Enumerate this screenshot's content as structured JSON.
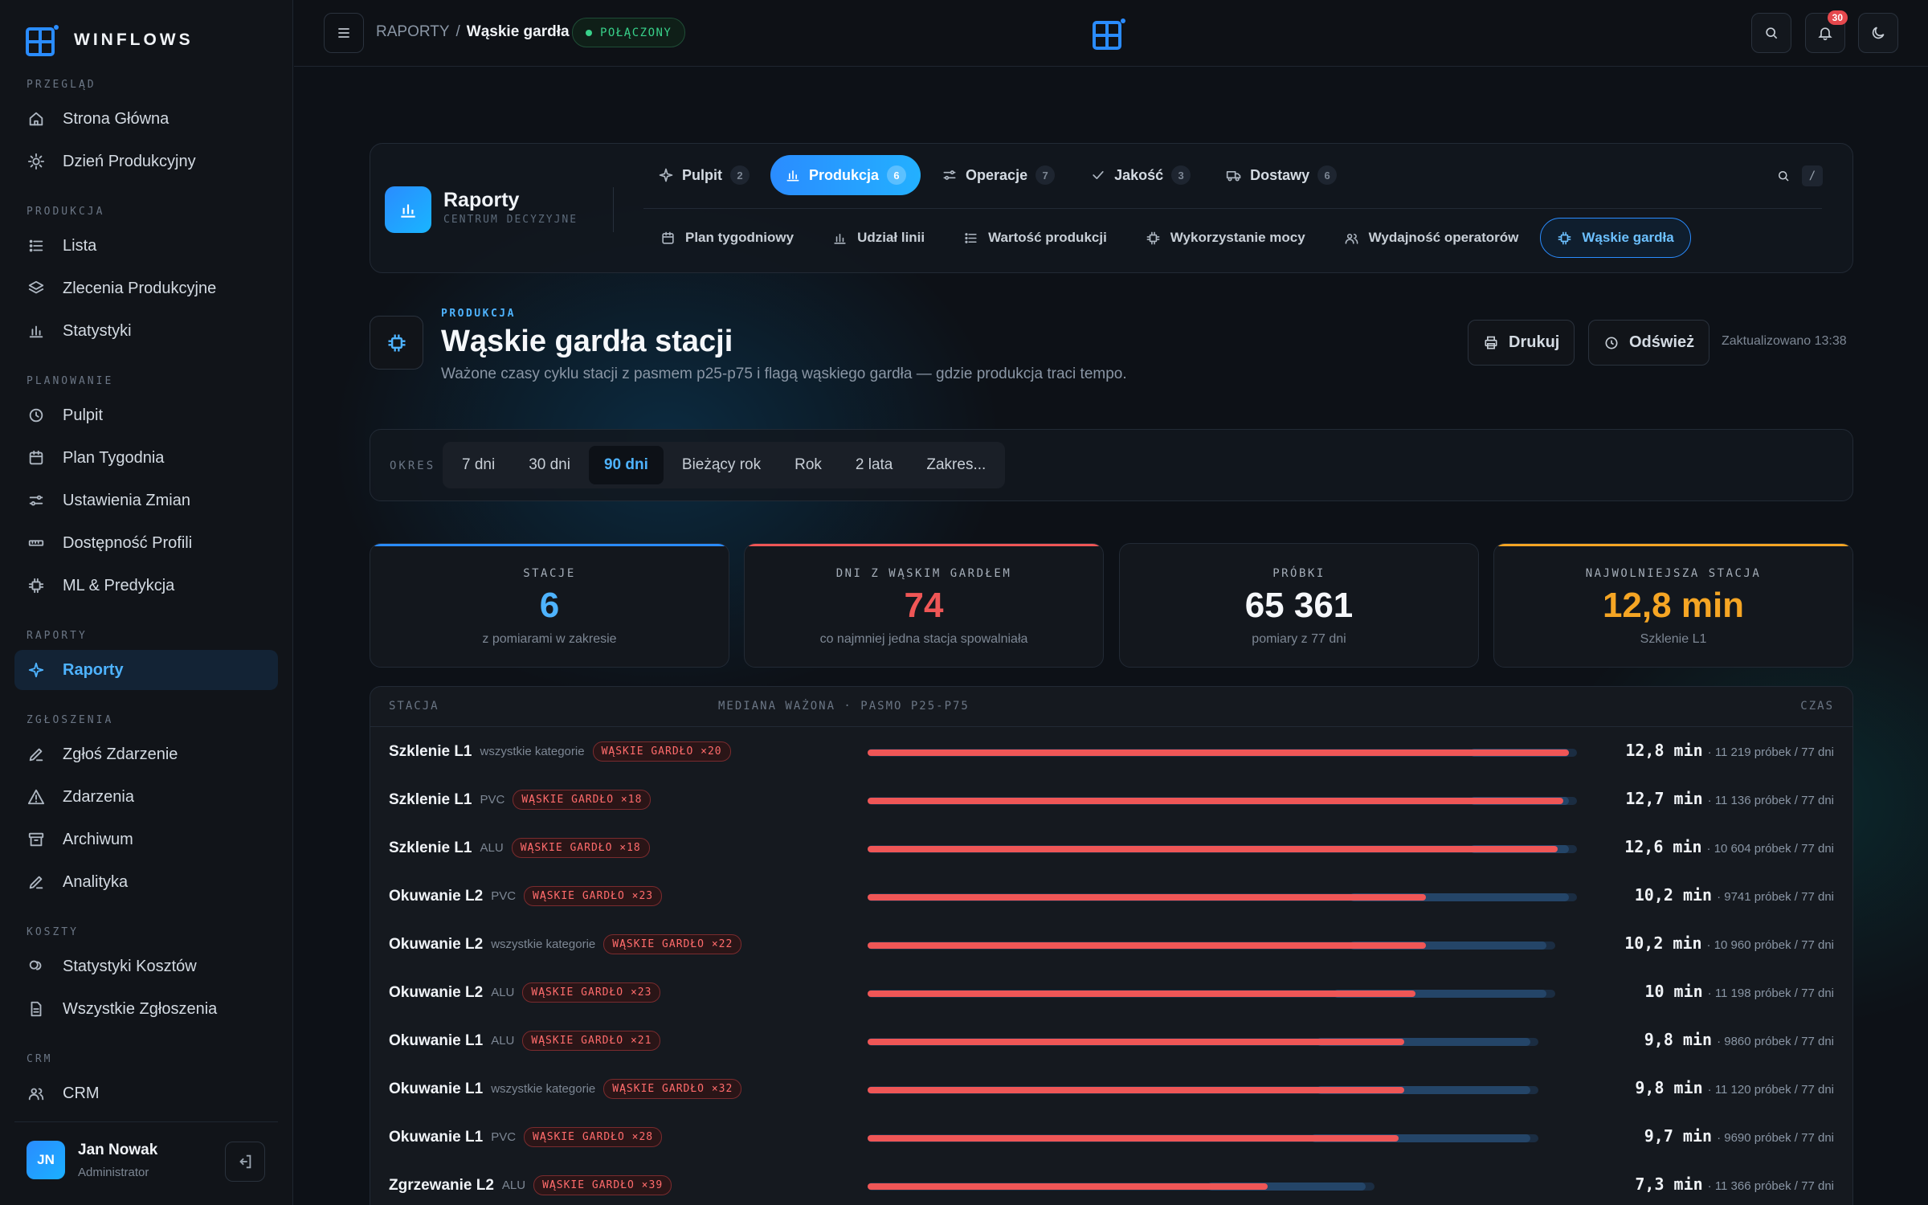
{
  "brand": {
    "name": "WINFLOWS"
  },
  "sidebar": {
    "sections": [
      {
        "title": "PRZEGLĄD",
        "items": [
          {
            "label": "Strona Główna",
            "icon": "home-icon"
          },
          {
            "label": "Dzień Produkcyjny",
            "icon": "sun-icon"
          }
        ]
      },
      {
        "title": "PRODUKCJA",
        "items": [
          {
            "label": "Lista",
            "icon": "list-icon"
          },
          {
            "label": "Zlecenia Produkcyjne",
            "icon": "layers-icon"
          },
          {
            "label": "Statystyki",
            "icon": "bar-chart-icon"
          }
        ]
      },
      {
        "title": "PLANOWANIE",
        "items": [
          {
            "label": "Pulpit",
            "icon": "clock-icon"
          },
          {
            "label": "Plan Tygodnia",
            "icon": "calendar-icon"
          },
          {
            "label": "Ustawienia Zmian",
            "icon": "sliders-icon"
          },
          {
            "label": "Dostępność Profili",
            "icon": "ruler-icon"
          },
          {
            "label": "ML & Predykcja",
            "icon": "chip-icon"
          }
        ]
      },
      {
        "title": "RAPORTY",
        "items": [
          {
            "label": "Raporty",
            "icon": "sparkle-icon",
            "active": true
          }
        ]
      },
      {
        "title": "ZGŁOSZENIA",
        "items": [
          {
            "label": "Zgłoś Zdarzenie",
            "icon": "pen-icon"
          },
          {
            "label": "Zdarzenia",
            "icon": "warning-icon"
          },
          {
            "label": "Archiwum",
            "icon": "archive-icon"
          },
          {
            "label": "Analityka",
            "icon": "pen-icon"
          }
        ]
      },
      {
        "title": "KOSZTY",
        "items": [
          {
            "label": "Statystyki Kosztów",
            "icon": "coins-icon"
          },
          {
            "label": "Wszystkie Zgłoszenia",
            "icon": "document-icon"
          }
        ]
      },
      {
        "title": "CRM",
        "items": [
          {
            "label": "CRM",
            "icon": "users-icon"
          }
        ]
      }
    ],
    "user": {
      "initials": "JN",
      "name": "Jan Nowak",
      "role": "Administrator"
    }
  },
  "topbar": {
    "breadcrumb": [
      "RAPORTY",
      "Wąskie gardła"
    ],
    "breadcrumb_sep": "/",
    "status": "POŁĄCZONY",
    "notifications": "30"
  },
  "reports": {
    "title": "Raporty",
    "subtitle": "CENTRUM DECYZYJNE",
    "search_key": "/",
    "tabs": [
      {
        "label": "Pulpit",
        "count": "2",
        "icon": "sparkle-icon"
      },
      {
        "label": "Produkcja",
        "count": "6",
        "icon": "bar-chart-icon",
        "active": true
      },
      {
        "label": "Operacje",
        "count": "7",
        "icon": "sliders-icon"
      },
      {
        "label": "Jakość",
        "count": "3",
        "icon": "check-icon"
      },
      {
        "label": "Dostawy",
        "count": "6",
        "icon": "truck-icon"
      }
    ],
    "subtabs": [
      {
        "label": "Plan tygodniowy",
        "icon": "calendar-icon"
      },
      {
        "label": "Udział linii",
        "icon": "bar-chart-icon"
      },
      {
        "label": "Wartość produkcji",
        "icon": "list-icon"
      },
      {
        "label": "Wykorzystanie mocy",
        "icon": "chip-icon"
      },
      {
        "label": "Wydajność operatorów",
        "icon": "users-icon"
      },
      {
        "label": "Wąskie gardła",
        "icon": "chip-icon",
        "active": true
      }
    ]
  },
  "page": {
    "kicker": "PRODUKCJA",
    "title": "Wąskie gardła stacji",
    "description": "Ważone czasy cyklu stacji z pasmem p25-p75 i flagą wąskiego gardła — gdzie produkcja traci tempo.",
    "print_label": "Drukuj",
    "refresh_label": "Odśwież",
    "updated": "Zaktualizowano 13:38"
  },
  "period": {
    "label": "OKRES",
    "options": [
      "7 dni",
      "30 dni",
      "90 dni",
      "Bieżący rok",
      "Rok",
      "2 lata",
      "Zakres..."
    ],
    "selected": "90 dni"
  },
  "kpis": [
    {
      "label": "STACJE",
      "value": "6",
      "caption": "z pomiarami w zakresie",
      "color": "#4eb3ff",
      "accent": "#2a8cff"
    },
    {
      "label": "DNI Z WĄSKIM GARDŁEM",
      "value": "74",
      "caption": "co najmniej jedna stacja spowalniała",
      "color": "#ef5656",
      "accent": "#ef5656"
    },
    {
      "label": "PRÓBKI",
      "value": "65 361",
      "caption": "pomiary z 77 dni",
      "color": "#f5f7fa",
      "accent": ""
    },
    {
      "label": "NAJWOLNIEJSZA STACJA",
      "value": "12,8 min",
      "caption": "Szklenie L1",
      "color": "#f5a524",
      "accent": "#f5a524"
    }
  ],
  "table": {
    "headers": {
      "station": "STACJA",
      "median": "MEDIANA WAŻONA · PASMO P25-P75",
      "time": "CZAS"
    },
    "scale_max": 13.2,
    "rows": [
      {
        "station": "Szklenie L1",
        "category": "wszystkie kategorie",
        "badge": "WĄSKIE GARDŁO ×20",
        "median": 12.8,
        "p25": 11.0,
        "p75": 12.8,
        "time": "12,8 min",
        "samples": "· 11 219 próbek / 77 dni"
      },
      {
        "station": "Szklenie L1",
        "category": "PVC",
        "badge": "WĄSKIE GARDŁO ×18",
        "median": 12.7,
        "p25": 11.0,
        "p75": 12.8,
        "time": "12,7 min",
        "samples": "· 11 136 próbek / 77 dni"
      },
      {
        "station": "Szklenie L1",
        "category": "ALU",
        "badge": "WĄSKIE GARDŁO ×18",
        "median": 12.6,
        "p25": 11.0,
        "p75": 12.8,
        "time": "12,6 min",
        "samples": "· 10 604 próbek / 77 dni"
      },
      {
        "station": "Okuwanie L2",
        "category": "PVC",
        "badge": "WĄSKIE GARDŁO ×23",
        "median": 10.2,
        "p25": 8.8,
        "p75": 12.8,
        "time": "10,2 min",
        "samples": "· 9741 próbek / 77 dni"
      },
      {
        "station": "Okuwanie L2",
        "category": "wszystkie kategorie",
        "badge": "WĄSKIE GARDŁO ×22",
        "median": 10.2,
        "p25": 8.8,
        "p75": 12.4,
        "time": "10,2 min",
        "samples": "· 10 960 próbek / 77 dni"
      },
      {
        "station": "Okuwanie L2",
        "category": "ALU",
        "badge": "WĄSKIE GARDŁO ×23",
        "median": 10.0,
        "p25": 8.5,
        "p75": 12.4,
        "time": "10 min",
        "samples": "· 11 198 próbek / 77 dni"
      },
      {
        "station": "Okuwanie L1",
        "category": "ALU",
        "badge": "WĄSKIE GARDŁO ×21",
        "median": 9.8,
        "p25": 8.2,
        "p75": 12.1,
        "time": "9,8 min",
        "samples": "· 9860 próbek / 77 dni"
      },
      {
        "station": "Okuwanie L1",
        "category": "wszystkie kategorie",
        "badge": "WĄSKIE GARDŁO ×32",
        "median": 9.8,
        "p25": 8.2,
        "p75": 12.1,
        "time": "9,8 min",
        "samples": "· 11 120 próbek / 77 dni"
      },
      {
        "station": "Okuwanie L1",
        "category": "PVC",
        "badge": "WĄSKIE GARDŁO ×28",
        "median": 9.7,
        "p25": 8.1,
        "p75": 12.1,
        "time": "9,7 min",
        "samples": "· 9690 próbek / 77 dni"
      },
      {
        "station": "Zgrzewanie L2",
        "category": "ALU",
        "badge": "WĄSKIE GARDŁO ×39",
        "median": 7.3,
        "p25": 6.2,
        "p75": 9.1,
        "time": "7,3 min",
        "samples": "· 11 366 próbek / 77 dni"
      }
    ]
  }
}
